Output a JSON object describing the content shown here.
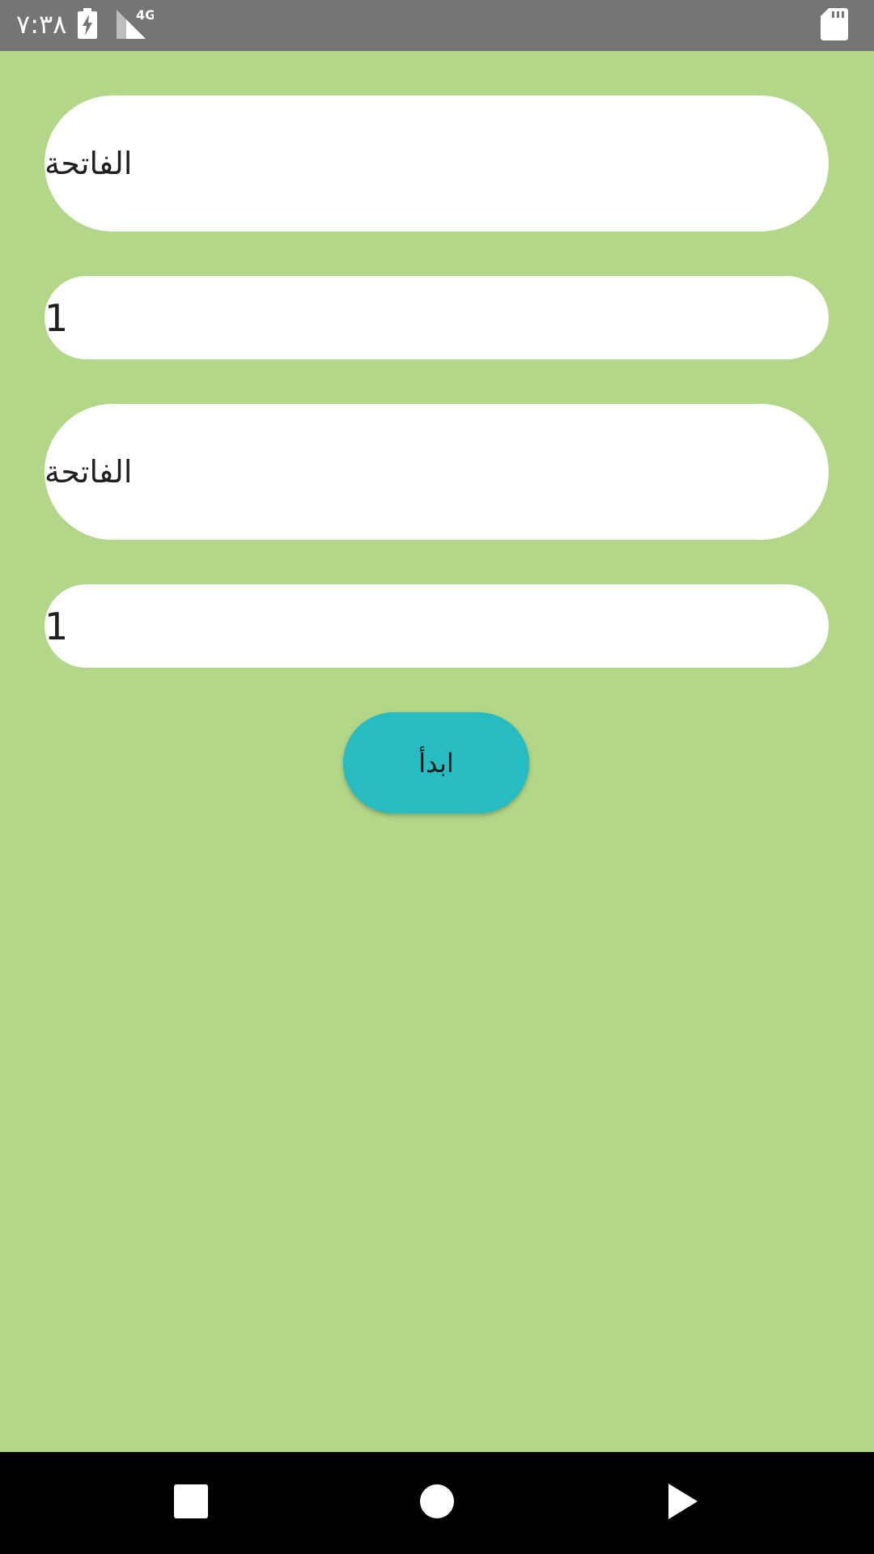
{
  "status_bar": {
    "time": "٧:٣٨",
    "network_label": "4G",
    "icons": [
      "battery-charging-icon",
      "cell-signal-icon",
      "sd-card-icon"
    ]
  },
  "form": {
    "from_surah": {
      "value": "الفاتحة"
    },
    "from_ayah": {
      "value": "1"
    },
    "to_surah": {
      "value": "الفاتحة"
    },
    "to_ayah": {
      "value": "1"
    },
    "start_label": "ابدأ"
  },
  "nav_bar": {
    "icons": [
      "recents-square-icon",
      "home-circle-icon",
      "back-triangle-icon"
    ]
  },
  "colors": {
    "background": "#b3d789",
    "status_bar": "#757575",
    "field": "#ffffff",
    "button": "#26bcc1",
    "nav_bar": "#000000"
  }
}
